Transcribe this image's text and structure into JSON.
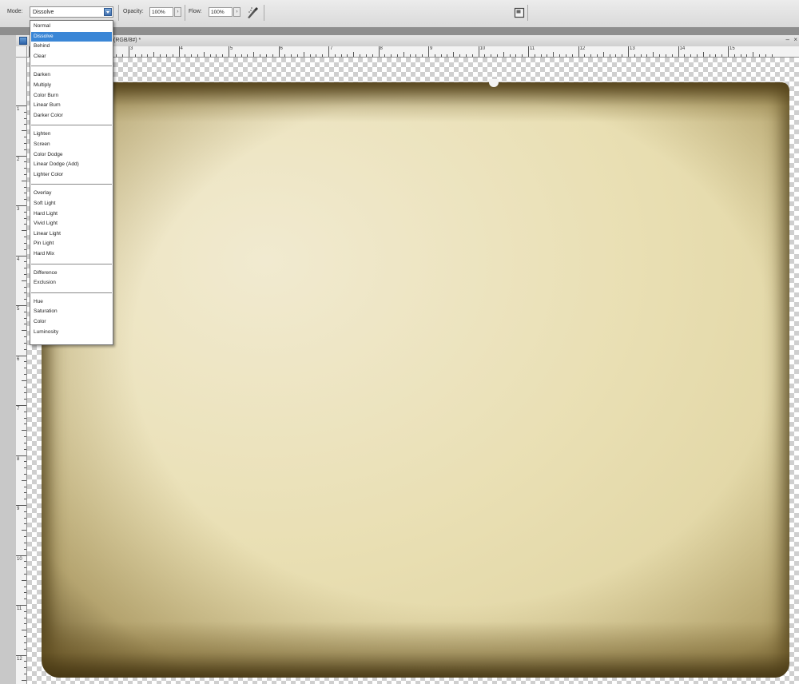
{
  "options_bar": {
    "mode_label": "Mode:",
    "mode_value": "Dissolve",
    "opacity_label": "Opacity:",
    "opacity_value": "100%",
    "flow_label": "Flow:",
    "flow_value": "100%",
    "airbrush_icon": "airbrush-icon",
    "panel_icon": "toggle-panel-icon"
  },
  "document": {
    "title": "(RGB/8#) *",
    "minimize": "–",
    "close": "×"
  },
  "blend_modes": {
    "selected": "Dissolve",
    "groups": [
      [
        "Normal",
        "Dissolve",
        "Behind",
        "Clear"
      ],
      [
        "Darken",
        "Multiply",
        "Color Burn",
        "Linear Burn",
        "Darker Color"
      ],
      [
        "Lighten",
        "Screen",
        "Color Dodge",
        "Linear Dodge (Add)",
        "Lighter Color"
      ],
      [
        "Overlay",
        "Soft Light",
        "Hard Light",
        "Vivid Light",
        "Linear Light",
        "Pin Light",
        "Hard Mix"
      ],
      [
        "Difference",
        "Exclusion"
      ],
      [
        "Hue",
        "Saturation",
        "Color",
        "Luminosity"
      ]
    ]
  },
  "ruler": {
    "top": [
      "1",
      "2",
      "3",
      "4",
      "5",
      "6",
      "7",
      "8",
      "9",
      "10",
      "11",
      "12",
      "13",
      "14",
      "15"
    ],
    "left": [
      "1",
      "2",
      "3",
      "4",
      "5",
      "6",
      "7",
      "8",
      "9",
      "10",
      "11",
      "12"
    ]
  },
  "colors": {
    "selection": "#3a86d6",
    "paper": "#e9dfb3",
    "paper_edge": "#5a4a1c"
  }
}
